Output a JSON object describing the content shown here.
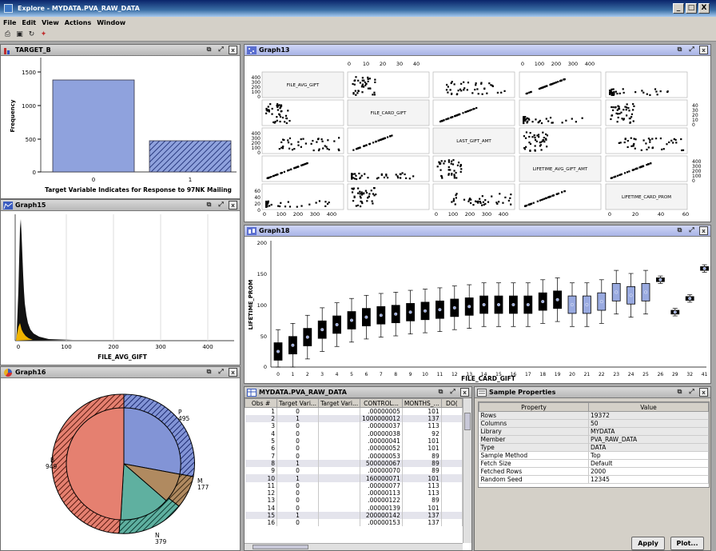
{
  "window": {
    "title": "Explore - MYDATA.PVA_RAW_DATA",
    "min": "_",
    "max": "□",
    "close": "X"
  },
  "menu": [
    "File",
    "Edit",
    "View",
    "Actions",
    "Window"
  ],
  "toolbar_icons": [
    "print-icon",
    "save-icon",
    "refresh-icon",
    "explore-icon"
  ],
  "panel_controls": {
    "restore": "▫",
    "maximize": "▫",
    "close": "x"
  },
  "target_b": {
    "title": "TARGET_B",
    "ylabel": "Frequency",
    "xlabel": "Target Variable Indicates for Response to 97NK Mailing",
    "yticks": [
      "1500",
      "1000",
      "500",
      "0"
    ],
    "xticks": [
      "0",
      "1"
    ]
  },
  "graph15": {
    "title": "Graph15",
    "xlabel": "FILE_AVG_GIFT",
    "xticks": [
      "0",
      "100",
      "200",
      "300",
      "400"
    ]
  },
  "graph16": {
    "title": "Graph16",
    "labels": {
      "p": "P",
      "p_n": "495",
      "b": "B",
      "b_n": "949",
      "m": "M",
      "m_n": "177",
      "n": "N",
      "n_n": "379"
    }
  },
  "graph13": {
    "title": "Graph13",
    "vars": [
      "FILE_AVG_GIFT",
      "FILE_CARD_GIFT",
      "LAST_GIFT_AMT",
      "LIFETIME_AVG_GIFT_AMT",
      "LIFETIME_CARD_PROM"
    ],
    "top_ticks_a": [
      "0",
      "10",
      "20",
      "30",
      "40"
    ],
    "top_ticks_b": [
      "0",
      "100",
      "200",
      "300",
      "400"
    ],
    "bottom_ticks_a": [
      "0",
      "100",
      "200",
      "300",
      "400"
    ],
    "bottom_ticks_b": [
      "0",
      "100",
      "200",
      "300",
      "400"
    ],
    "bottom_ticks_c": [
      "0",
      "20",
      "40",
      "60"
    ],
    "left_ticks_1": [
      "400",
      "300",
      "200",
      "100",
      "0"
    ],
    "left_ticks_3": [
      "400",
      "300",
      "200",
      "100",
      "0"
    ],
    "left_ticks_5": [
      "60",
      "40",
      "20",
      "0"
    ],
    "right_ticks_2": [
      "40",
      "30",
      "20",
      "10",
      "0"
    ],
    "right_ticks_4": [
      "400",
      "300",
      "200",
      "100",
      "0"
    ]
  },
  "graph18": {
    "title": "Graph18",
    "xlabel": "FILE_CARD_GIFT",
    "ylabel": "LIFETIME_PROM",
    "yticks": [
      "200",
      "150",
      "100",
      "50",
      "0"
    ],
    "xticks": [
      "0",
      "1",
      "2",
      "3",
      "4",
      "5",
      "6",
      "7",
      "8",
      "9",
      "10",
      "11",
      "12",
      "13",
      "14",
      "15",
      "16",
      "17",
      "18",
      "19",
      "20",
      "21",
      "22",
      "23",
      "24",
      "25",
      "26",
      "29",
      "32",
      "41"
    ]
  },
  "datatable": {
    "title": "MYDATA.PVA_RAW_DATA",
    "columns": [
      "Obs #",
      "Target Vari...",
      "Target Vari...",
      "CONTROL...",
      "MONTHS_...",
      "DO("
    ],
    "rows": [
      [
        "1",
        "0",
        ".00000005",
        "101"
      ],
      [
        "2",
        "1",
        "1000000012",
        "137"
      ],
      [
        "3",
        "0",
        ".00000037",
        "113"
      ],
      [
        "4",
        "0",
        ".00000038",
        "92"
      ],
      [
        "5",
        "0",
        ".00000041",
        "101"
      ],
      [
        "6",
        "0",
        ".00000052",
        "101"
      ],
      [
        "7",
        "0",
        ".00000053",
        "89"
      ],
      [
        "8",
        "1",
        "500000067",
        "89"
      ],
      [
        "9",
        "0",
        ".00000070",
        "89"
      ],
      [
        "10",
        "1",
        "160000071",
        "101"
      ],
      [
        "11",
        "0",
        ".00000077",
        "113"
      ],
      [
        "12",
        "0",
        ".00000113",
        "113"
      ],
      [
        "13",
        "0",
        ".00000122",
        "89"
      ],
      [
        "14",
        "0",
        ".00000139",
        "101"
      ],
      [
        "15",
        "1",
        "200000142",
        "137"
      ],
      [
        "16",
        "0",
        ".00000153",
        "137"
      ]
    ]
  },
  "sample": {
    "title": "Sample Properties",
    "col_property": "Property",
    "col_value": "Value",
    "rows": [
      [
        "Rows",
        "19372"
      ],
      [
        "Columns",
        "50"
      ],
      [
        "Library",
        "MYDATA"
      ],
      [
        "Member",
        "PVA_RAW_DATA"
      ],
      [
        "Type",
        "DATA"
      ],
      [
        "Sample Method",
        "Top"
      ],
      [
        "Fetch Size",
        "Default"
      ],
      [
        "Fetched Rows",
        "2000"
      ],
      [
        "Random Seed",
        "12345"
      ]
    ],
    "apply": "Apply",
    "plot": "Plot..."
  },
  "colors": {
    "bar": "#8fa2dd",
    "box": "#99aae0",
    "pie_p": "#8294d6",
    "pie_b": "#e58070",
    "pie_n": "#5fb0a0",
    "pie_m": "#b08a60"
  }
}
